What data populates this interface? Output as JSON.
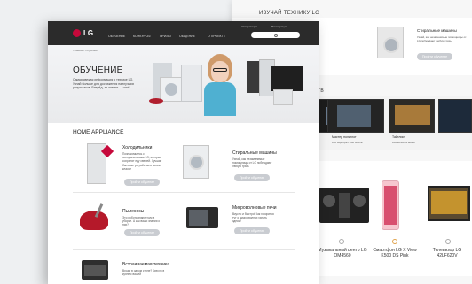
{
  "back_page": {
    "heading": "ИЗУЧАЙ ТЕХНИКУ LG",
    "top_row": [
      {
        "title": "Холодильники",
        "desc": "Познакомьтесь с холодильниками LG, которые сохранят еду свежей",
        "button": "Пройти обучение"
      },
      {
        "title": "Стиральные машины",
        "desc": "Узнай, как незаменимые помощницы от LG побеждают любую грязь",
        "button": "Пройти обучение"
      }
    ],
    "tv_section_label": "ТВ",
    "tv_cards": [
      {
        "title": "Мастер полиглот",
        "stats": "100 серебра • 200 опыта"
      },
      {
        "title": "Тайтлист",
        "stats": "100 золотых монет"
      }
    ],
    "products": [
      {
        "name": "Музыкальный центр LG OM4560"
      },
      {
        "name": "Смартфон LG X View K500 DS Pink"
      },
      {
        "name": "Телевизор LG 42LF620V"
      }
    ]
  },
  "nav": {
    "logo": "LG",
    "auth": "Авторизация",
    "register": "Регистрация",
    "search_placeholder": "",
    "items": [
      "ОБУЧЕНИЕ",
      "КОНКУРСЫ",
      "ПРИЗЫ",
      "ОБЩЕНИЕ",
      "О ПРОЕКТЕ"
    ]
  },
  "hero": {
    "breadcrumb": "Главная • Обучение",
    "title": "ОБУЧЕНИЕ",
    "description": "Самая свежая информация о технике LG. Узнай больше для достижения наилучших результатов. Вперёд, за знания — они!"
  },
  "section_title": "HOME APPLIANCE",
  "categories": [
    {
      "title": "Холодильники",
      "desc": "Познакомьтесь с холодильниками LG, которые сохранят еду свежей. Лучшие бытовые устройства в своем классе",
      "button": "Пройти обучение"
    },
    {
      "title": "Стиральные машины",
      "desc": "Узнай, как незаменимые помощницы от LG побеждают любую грязь",
      "button": "Пройти обучение"
    },
    {
      "title": "Пылесосы",
      "desc": "Это робота знают толк в уборке. А как ваши знания о них?",
      "button": "Пройти обучение"
    },
    {
      "title": "Микроволновые печи",
      "desc": "Вкусно и быстро! Как говорится тут о микро-волнах узнать здесь?",
      "button": "Пройти обучение"
    },
    {
      "title": "Встраиваемая техника",
      "desc": "Вроде в одном стиле? Кресло в кухне с вашей"
    }
  ],
  "colors": {
    "brand": "#c6093b",
    "nav_bg": "#2b2b2b",
    "button": "#c9ccd1"
  }
}
